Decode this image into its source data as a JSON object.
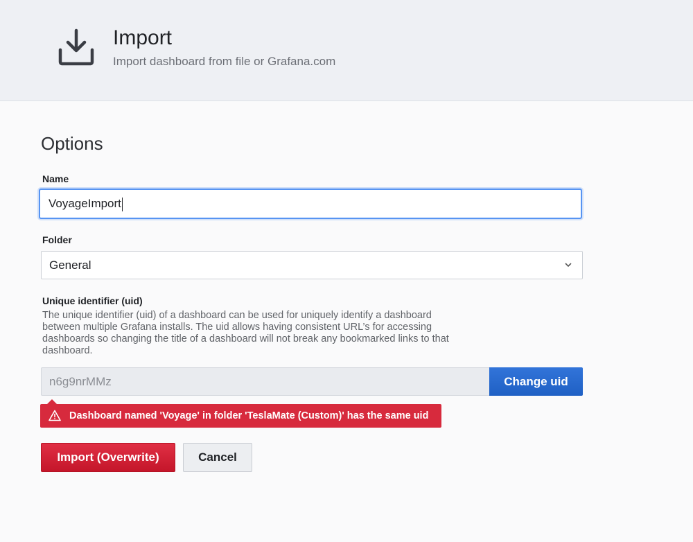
{
  "header": {
    "title": "Import",
    "subtitle": "Import dashboard from file or Grafana.com",
    "icon": "download-icon"
  },
  "options": {
    "title": "Options",
    "name": {
      "label": "Name",
      "value": "VoyageImport"
    },
    "folder": {
      "label": "Folder",
      "value": "General",
      "icon": "chevron-down-icon"
    },
    "uid": {
      "label": "Unique identifier (uid)",
      "description": "The unique identifier (uid) of a dashboard can be used for uniquely identify a dashboard between multiple Grafana installs. The uid allows having consistent URL’s for accessing dashboards so changing the title of a dashboard will not break any bookmarked links to that dashboard.",
      "value": "n6g9nrMMz",
      "change_button": "Change uid"
    },
    "error": {
      "icon": "warning-icon",
      "message": "Dashboard named 'Voyage' in folder 'TeslaMate (Custom)' has the same uid"
    }
  },
  "actions": {
    "import_label": "Import (Overwrite)",
    "cancel_label": "Cancel"
  },
  "colors": {
    "primary": "#3274d9",
    "destructive": "#e02f44",
    "focus": "#5794f2"
  }
}
